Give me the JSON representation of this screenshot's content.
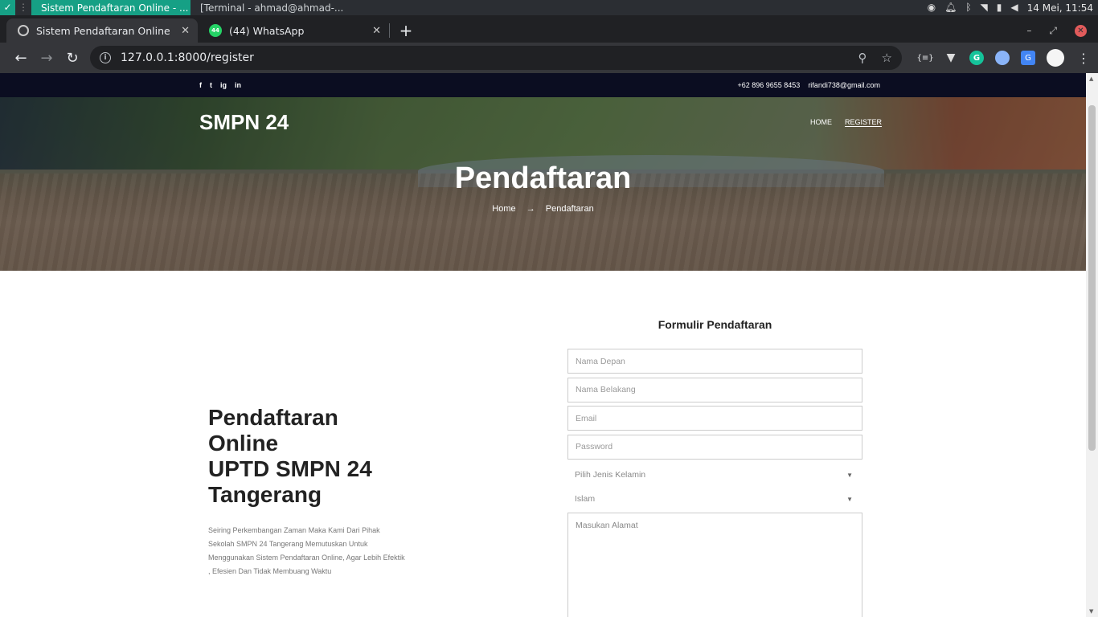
{
  "taskbar": {
    "active_app": "Sistem Pendaftaran Online - ...",
    "terminal_app": "[Terminal - ahmad@ahmad-...",
    "clock": "14 Mei, 11:54"
  },
  "tabs": [
    {
      "title": "Sistem Pendaftaran Online"
    },
    {
      "title": "(44) WhatsApp",
      "badge": "44"
    }
  ],
  "toolbar": {
    "url": "127.0.0.1:8000/register"
  },
  "site": {
    "social": [
      "f",
      "t",
      "ig",
      "in"
    ],
    "phone": "+62 896 9655 8453",
    "email": "rifandi738@gmail.com",
    "brand": "SMPN 24",
    "nav": [
      "HOME",
      "REGISTER"
    ],
    "hero_title": "Pendaftaran",
    "breadcrumb": {
      "home": "Home",
      "arrow": "→",
      "current": "Pendaftaran"
    }
  },
  "intro": {
    "title": "Pendaftaran\nOnline\nUPTD SMPN 24\nTangerang",
    "description": "Seiring Perkembangan Zaman Maka Kami Dari Pihak Sekolah SMPN 24 Tangerang Memutuskan Untuk Menggunakan Sistem Pendaftaran Online, Agar Lebih Efektik , Efesien Dan Tidak Membuang Waktu"
  },
  "form": {
    "title": "Formulir Pendaftaran",
    "first_name_placeholder": "Nama Depan",
    "last_name_placeholder": "Nama Belakang",
    "email_placeholder": "Email",
    "password_placeholder": "Password",
    "gender_select": "Pilih Jenis Kelamin",
    "religion_select": "Islam",
    "address_placeholder": "Masukan Alamat"
  }
}
